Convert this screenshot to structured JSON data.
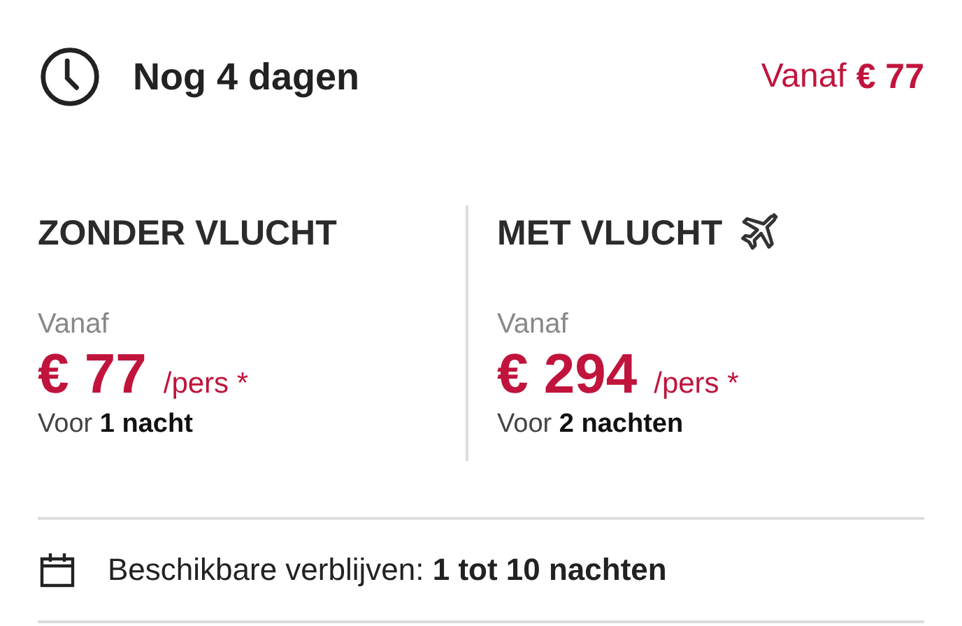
{
  "header": {
    "countdown": "Nog 4 dagen",
    "from_label": "Vanaf",
    "from_price": "€ 77"
  },
  "offers": [
    {
      "kind": "no_flight",
      "title": "ZONDER VLUCHT",
      "from_label": "Vanaf",
      "price": "€ 77",
      "unit": "/pers *",
      "duration": "Voor **1 nacht**"
    },
    {
      "kind": "flight",
      "title": "MET VLUCHT",
      "from_label": "Vanaf",
      "price": "€ 294",
      "unit": "/pers *",
      "duration": "Voor **2 nachten**"
    }
  ],
  "availability": "Beschikbare verblijven: **1 tot 10 nachten**"
}
